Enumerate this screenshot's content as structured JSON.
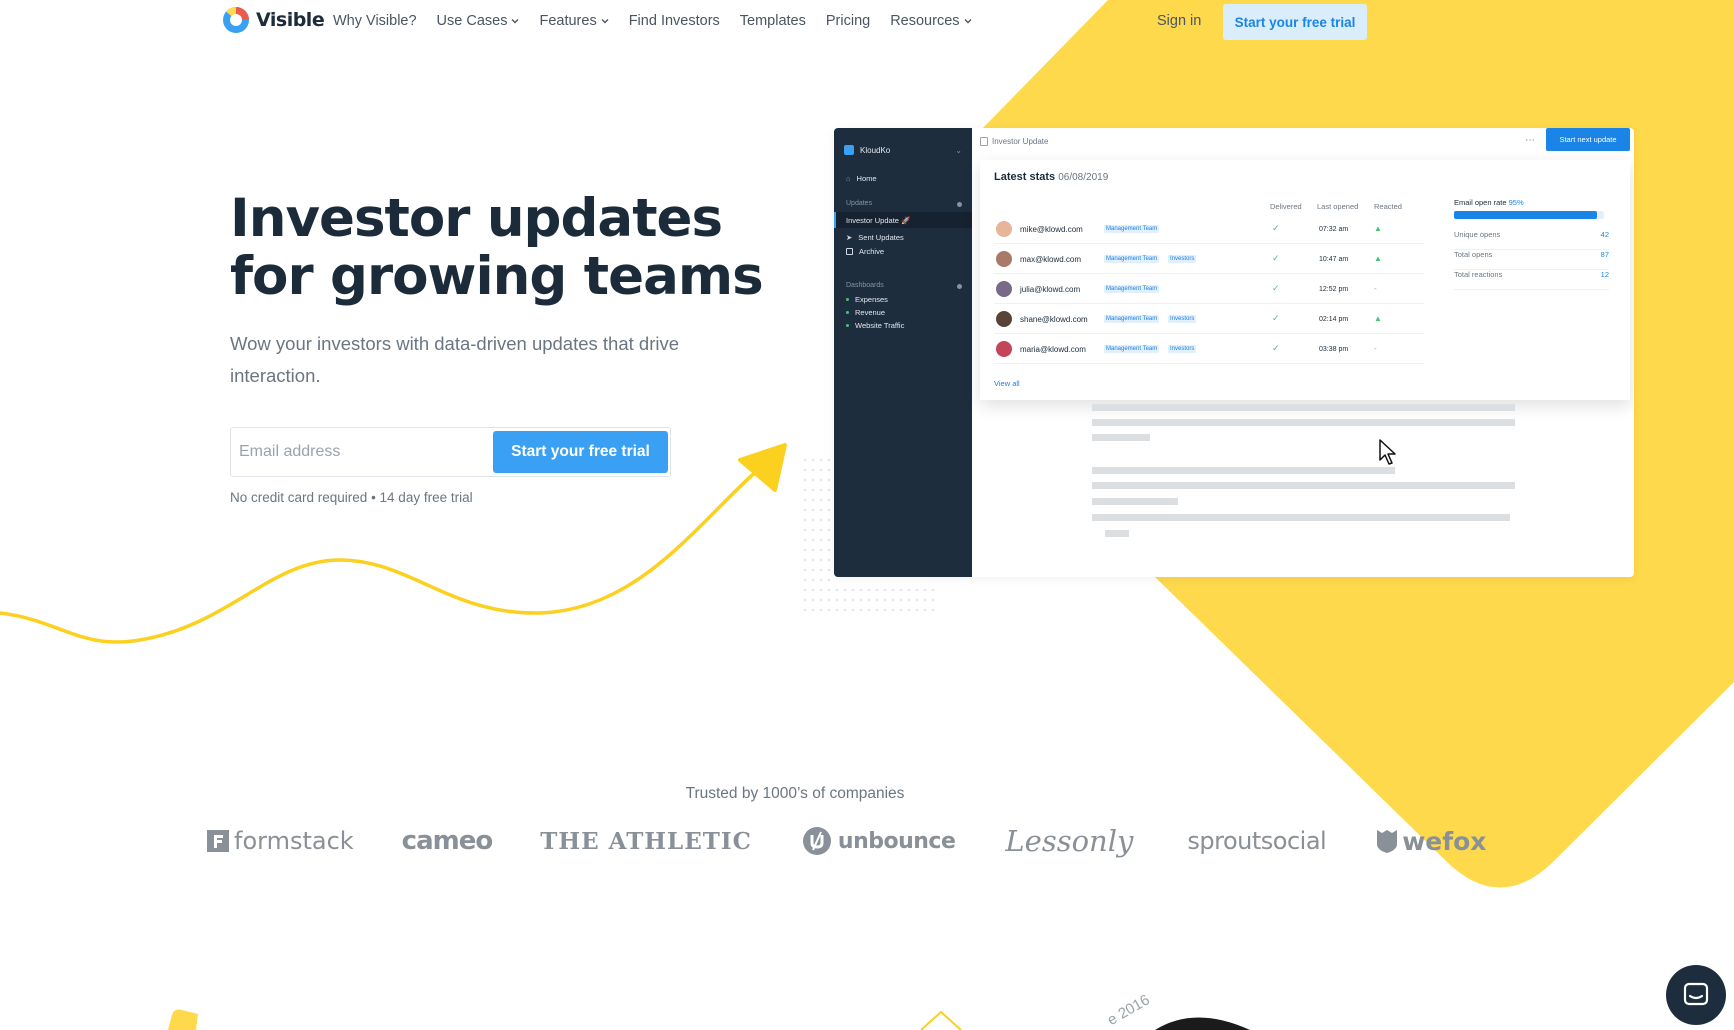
{
  "nav": {
    "logo_text": "Visible",
    "links": [
      {
        "label": "Why Visible?",
        "dropdown": false
      },
      {
        "label": "Use Cases",
        "dropdown": true
      },
      {
        "label": "Features",
        "dropdown": true
      },
      {
        "label": "Find Investors",
        "dropdown": false
      },
      {
        "label": "Templates",
        "dropdown": false
      },
      {
        "label": "Pricing",
        "dropdown": false
      },
      {
        "label": "Resources",
        "dropdown": true
      }
    ],
    "signin_label": "Sign in",
    "cta_label": "Start your free trial"
  },
  "hero": {
    "title_line1": "Investor updates",
    "title_line2": "for growing teams",
    "subtitle": "Wow your investors with data-driven updates that drive interaction.",
    "email_placeholder": "Email address",
    "cta_label": "Start your free trial",
    "note": "No credit card required • 14 day free trial"
  },
  "app": {
    "company": "KloudKo",
    "sidebar": {
      "home": "Home",
      "updates_section": "Updates",
      "updates": [
        "Investor Update 🚀",
        "Sent Updates",
        "Archive"
      ],
      "dashboards_section": "Dashboards",
      "dashboards": [
        "Expenses",
        "Revenue",
        "Website Traffic"
      ]
    },
    "doc_title": "Investor Update",
    "more_icon": "more-dots-icon",
    "next_button": "Start next update",
    "stats": {
      "title": "Latest stats",
      "date": "06/08/2019",
      "columns": [
        "Delivered",
        "Last opened",
        "Reacted"
      ],
      "rows": [
        {
          "email": "mike@klowd.com",
          "tags": [
            "Management Team"
          ],
          "delivered": "✓",
          "last_opened": "07:32 am",
          "reacted": "👍"
        },
        {
          "email": "max@klowd.com",
          "tags": [
            "Management Team",
            "Investors"
          ],
          "delivered": "✓",
          "last_opened": "10:47 am",
          "reacted": "👍"
        },
        {
          "email": "julia@klowd.com",
          "tags": [
            "Management Team"
          ],
          "delivered": "✓",
          "last_opened": "12:52 pm",
          "reacted": "-"
        },
        {
          "email": "shane@klowd.com",
          "tags": [
            "Management Team",
            "Investors"
          ],
          "delivered": "✓",
          "last_opened": "02:14 pm",
          "reacted": "👍"
        },
        {
          "email": "maria@klowd.com",
          "tags": [
            "Management Team",
            "Investors"
          ],
          "delivered": "✓",
          "last_opened": "03:38 pm",
          "reacted": "-"
        }
      ],
      "view_all": "View all",
      "open_rate_label": "Email open rate",
      "open_rate_value": "95%",
      "open_rate_fraction": 0.95,
      "metrics": [
        {
          "label": "Unique opens",
          "value": "42"
        },
        {
          "label": "Total opens",
          "value": "87"
        },
        {
          "label": "Total reactions",
          "value": "12"
        }
      ]
    }
  },
  "trusted": {
    "heading": "Trusted by 1000’s of companies",
    "logos": [
      "formstack",
      "cameo",
      "THE ATHLETIC",
      "unbounce",
      "Lessonly",
      "sproutsocial",
      "wefox"
    ]
  },
  "footer_peek": {
    "year_text": "e 2016"
  },
  "colors": {
    "yellow": "#fdd94b",
    "primary": "#3aa0f3",
    "navy": "#1e2d3d"
  }
}
